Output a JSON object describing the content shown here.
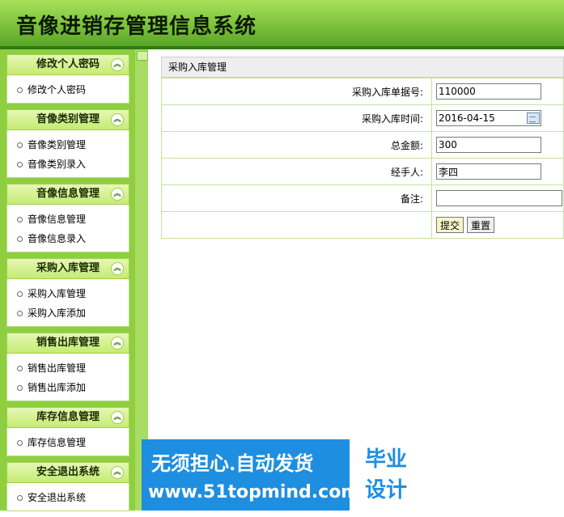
{
  "app": {
    "title": "音像进销存管理信息系统"
  },
  "sidebar": {
    "groups": [
      {
        "title": "修改个人密码",
        "items": [
          "修改个人密码"
        ]
      },
      {
        "title": "音像类别管理",
        "items": [
          "音像类别管理",
          "音像类别录入"
        ]
      },
      {
        "title": "音像信息管理",
        "items": [
          "音像信息管理",
          "音像信息录入"
        ]
      },
      {
        "title": "采购入库管理",
        "items": [
          "采购入库管理",
          "采购入库添加"
        ]
      },
      {
        "title": "销售出库管理",
        "items": [
          "销售出库管理",
          "销售出库添加"
        ]
      },
      {
        "title": "库存信息管理",
        "items": [
          "库存信息管理"
        ]
      },
      {
        "title": "安全退出系统",
        "items": [
          "安全退出系统"
        ]
      }
    ]
  },
  "form": {
    "title": "采购入库管理",
    "fields": [
      {
        "label": "采购入库单据号:",
        "value": "110000"
      },
      {
        "label": "采购入库时间:",
        "value": "2016-04-15"
      },
      {
        "label": "总金额:",
        "value": "300"
      },
      {
        "label": "经手人:",
        "value": "李四"
      },
      {
        "label": "备注:",
        "value": ""
      }
    ],
    "submit_label": "提交",
    "reset_label": "重置"
  },
  "banner": {
    "line1": "无须担心.自动发货",
    "line2": "www.51topmind.com",
    "badge_top": "毕业",
    "badge_bottom": "设计"
  },
  "colors": {
    "header": "#7cc23a",
    "sidebar": "#8fcf3f",
    "banner": "#1e8ee0"
  }
}
